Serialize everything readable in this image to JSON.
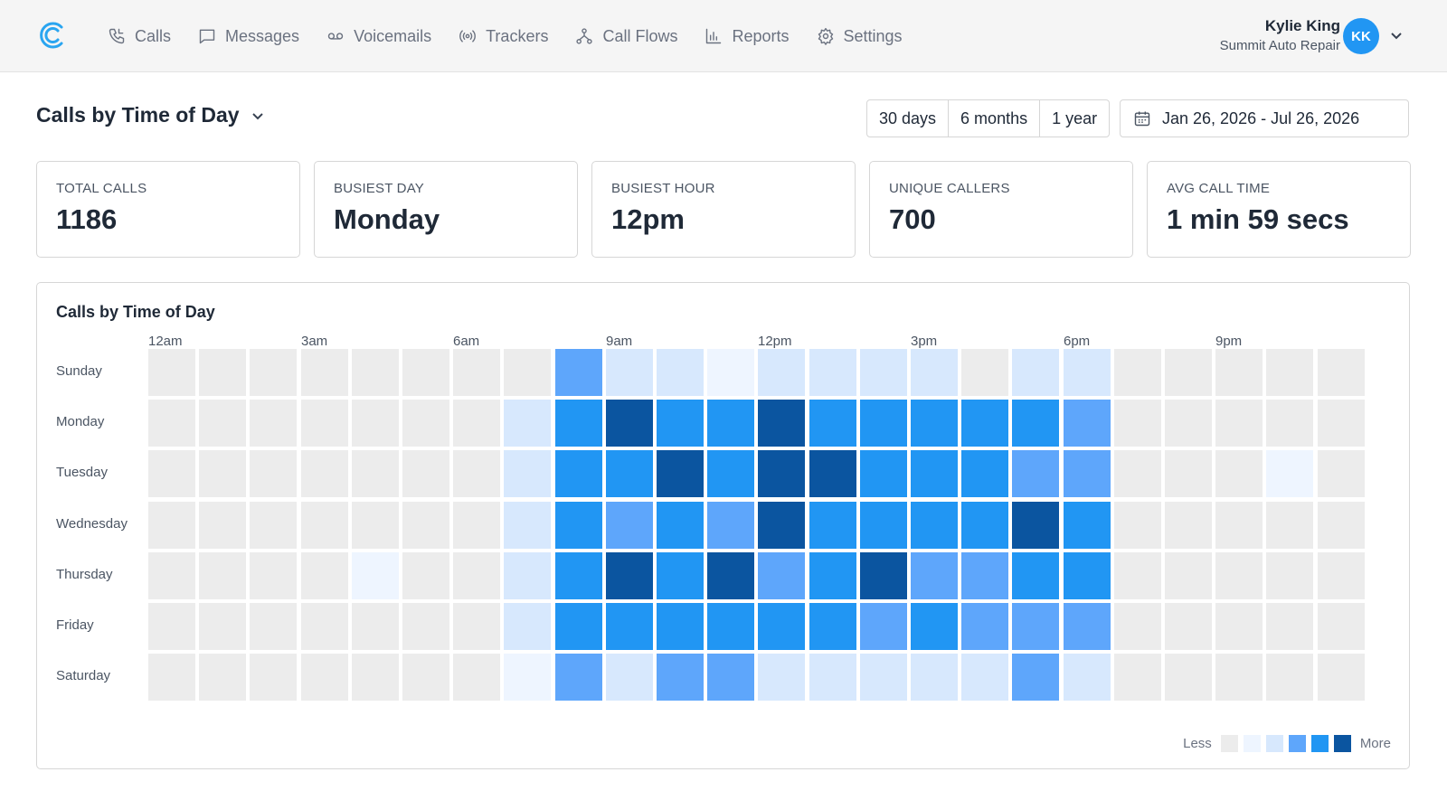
{
  "nav": {
    "items": [
      {
        "label": "Calls",
        "icon": "phone-icon"
      },
      {
        "label": "Messages",
        "icon": "message-icon"
      },
      {
        "label": "Voicemails",
        "icon": "voicemail-icon"
      },
      {
        "label": "Trackers",
        "icon": "broadcast-icon"
      },
      {
        "label": "Call Flows",
        "icon": "flow-icon"
      },
      {
        "label": "Reports",
        "icon": "bar-chart-icon"
      },
      {
        "label": "Settings",
        "icon": "gear-icon"
      }
    ]
  },
  "user": {
    "name": "Kylie King",
    "org": "Summit Auto Repair",
    "initials": "KK"
  },
  "page": {
    "title": "Calls by Time of Day"
  },
  "ranges": [
    "30 days",
    "6 months",
    "1 year"
  ],
  "date_range": "Jan 26, 2026 - Jul 26, 2026",
  "stats": [
    {
      "label": "TOTAL CALLS",
      "value": "1186"
    },
    {
      "label": "BUSIEST DAY",
      "value": "Monday"
    },
    {
      "label": "BUSIEST HOUR",
      "value": "12pm"
    },
    {
      "label": "UNIQUE CALLERS",
      "value": "700"
    },
    {
      "label": "AVG CALL TIME",
      "value": "1 min 59 secs"
    }
  ],
  "heatmap": {
    "title": "Calls by Time of Day",
    "hour_labels": [
      "12am",
      "3am",
      "6am",
      "9am",
      "12pm",
      "3pm",
      "6pm",
      "9pm"
    ],
    "legend_less": "Less",
    "legend_more": "More",
    "colors": [
      "#ececec",
      "#eef5ff",
      "#d7e8fd",
      "#5ea6fb",
      "#2196f3",
      "#0b55a0"
    ]
  },
  "chart_data": {
    "type": "heatmap",
    "title": "Calls by Time of Day",
    "rows": [
      "Sunday",
      "Monday",
      "Tuesday",
      "Wednesday",
      "Thursday",
      "Friday",
      "Saturday"
    ],
    "columns": [
      "12am",
      "1am",
      "2am",
      "3am",
      "4am",
      "5am",
      "6am",
      "7am",
      "8am",
      "9am",
      "10am",
      "11am",
      "12pm",
      "1pm",
      "2pm",
      "3pm",
      "4pm",
      "5pm",
      "6pm",
      "7pm",
      "8pm",
      "9pm",
      "10pm",
      "11pm"
    ],
    "scale": "intensity level 0 (less) to 5 (more)",
    "levels": [
      [
        0,
        0,
        0,
        0,
        0,
        0,
        0,
        0,
        3,
        2,
        2,
        1,
        2,
        2,
        2,
        2,
        0,
        2,
        2,
        0,
        0,
        0,
        0,
        0
      ],
      [
        0,
        0,
        0,
        0,
        0,
        0,
        0,
        2,
        4,
        5,
        4,
        4,
        5,
        4,
        4,
        4,
        4,
        4,
        3,
        0,
        0,
        0,
        0,
        0
      ],
      [
        0,
        0,
        0,
        0,
        0,
        0,
        0,
        2,
        4,
        4,
        5,
        4,
        5,
        5,
        4,
        4,
        4,
        3,
        3,
        0,
        0,
        0,
        1,
        0
      ],
      [
        0,
        0,
        0,
        0,
        0,
        0,
        0,
        2,
        4,
        3,
        4,
        3,
        5,
        4,
        4,
        4,
        4,
        5,
        4,
        0,
        0,
        0,
        0,
        0
      ],
      [
        0,
        0,
        0,
        0,
        1,
        0,
        0,
        2,
        4,
        5,
        4,
        5,
        3,
        4,
        5,
        3,
        3,
        4,
        4,
        0,
        0,
        0,
        0,
        0
      ],
      [
        0,
        0,
        0,
        0,
        0,
        0,
        0,
        2,
        4,
        4,
        4,
        4,
        4,
        4,
        3,
        4,
        3,
        3,
        3,
        0,
        0,
        0,
        0,
        0
      ],
      [
        0,
        0,
        0,
        0,
        0,
        0,
        0,
        1,
        3,
        2,
        3,
        3,
        2,
        2,
        2,
        2,
        2,
        3,
        2,
        0,
        0,
        0,
        0,
        0
      ]
    ]
  }
}
